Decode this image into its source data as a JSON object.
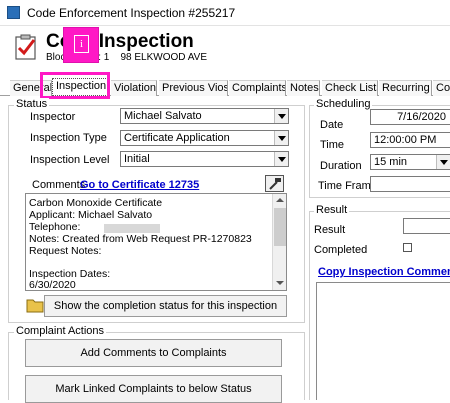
{
  "window": {
    "title": "Code Enforcement Inspection #255217"
  },
  "header": {
    "title": "Code Inspection",
    "subline": "Block: 1 Lot: 1    98 ELKWOOD AVE"
  },
  "tabs": [
    {
      "label": "General"
    },
    {
      "label": "Inspection"
    },
    {
      "label": "Violations"
    },
    {
      "label": "Previous Vios"
    },
    {
      "label": "Complaints"
    },
    {
      "label": "Notes"
    },
    {
      "label": "Check Lists"
    },
    {
      "label": "Recurring"
    },
    {
      "label": "Co"
    }
  ],
  "status": {
    "group_label": "Status",
    "inspector_label": "Inspector",
    "inspector_value": "Michael Salvato",
    "type_label": "Inspection Type",
    "type_value": "Certificate Application",
    "level_label": "Inspection Level",
    "level_value": "Initial",
    "comments_label": "Comments",
    "comments_link": "Go to Certificate 12735",
    "notes_lines": [
      "Carbon Monoxide Certificate",
      "Applicant: Michael Salvato",
      "Telephone:",
      "Notes: Created from Web Request PR-1270823",
      "Request Notes:",
      "",
      "Inspection Dates:",
      "6/30/2020"
    ],
    "completion_button": "Show the completion status for this inspection"
  },
  "complaint_actions": {
    "group_label": "Complaint Actions",
    "add_button": "Add Comments to Complaints",
    "mark_button": "Mark Linked Complaints to below Status"
  },
  "scheduling": {
    "group_label": "Scheduling",
    "date_label": "Date",
    "date_value": "7/16/2020",
    "time_label": "Time",
    "time_value": "12:00:00 PM",
    "duration_label": "Duration",
    "duration_value": "15 min",
    "timeframe_label": "Time Frame",
    "timeframe_value": ""
  },
  "result": {
    "group_label": "Result",
    "result_label": "Result",
    "completed_label": "Completed",
    "completed_checked": false,
    "copy_link": "Copy Inspection Comments"
  },
  "colors": {
    "highlight": "#ff18c5",
    "link": "#0000cc"
  }
}
